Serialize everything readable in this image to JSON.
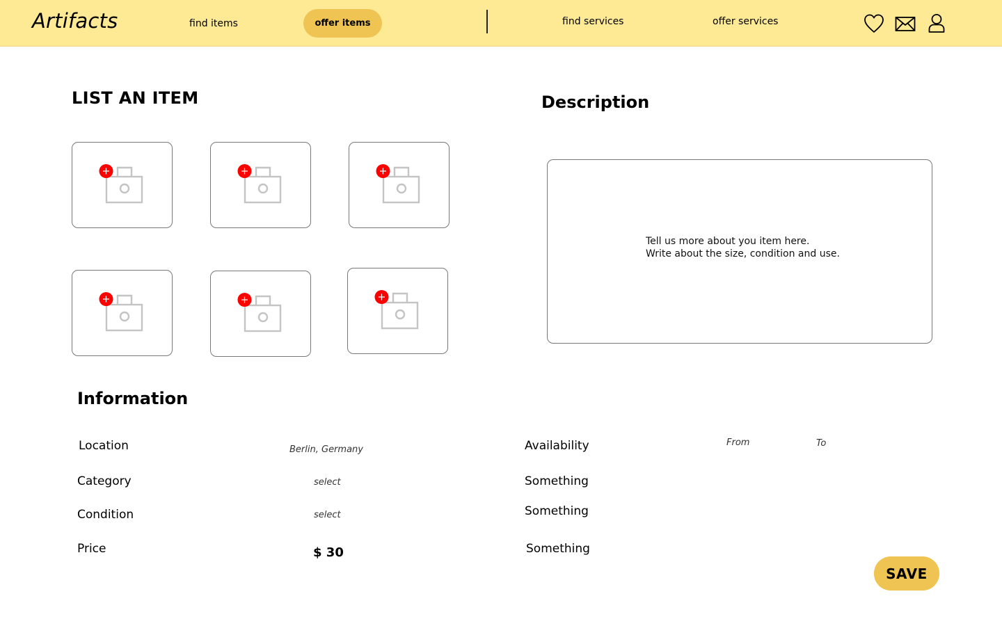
{
  "header": {
    "brand": "Artifacts",
    "nav": {
      "find_items": "find items",
      "offer_items": "offer items",
      "find_services": "find services",
      "offer_services": "offer services"
    },
    "icons": [
      "heart-icon",
      "mail-icon",
      "user-icon"
    ]
  },
  "main": {
    "list_title": "LIST AN ITEM",
    "photo_slots": [
      {
        "icon": "add-photo-icon"
      },
      {
        "icon": "add-photo-icon"
      },
      {
        "icon": "add-photo-icon"
      },
      {
        "icon": "add-photo-icon"
      },
      {
        "icon": "add-photo-icon"
      },
      {
        "icon": "add-photo-icon"
      }
    ],
    "description_title": "Description",
    "description_placeholder_line1": "Tell us more about you item here.",
    "description_placeholder_line2": "Write about the size, condition and use."
  },
  "information": {
    "title": "Information",
    "location_label": "Location",
    "location_value": "Berlin, Germany",
    "category_label": "Category",
    "category_value": "select",
    "condition_label": "Condition",
    "condition_value": "select",
    "price_label": "Price",
    "price_value": "$ 30",
    "availability_label": "Availability",
    "availability_from": "From",
    "availability_to": "To",
    "extra_1": "Something",
    "extra_2": "Something",
    "extra_3": "Something"
  },
  "actions": {
    "save_label": "SAVE"
  },
  "colors": {
    "header_bg": "#FEE995",
    "accent": "#EFC452",
    "add_badge": "#FF0000",
    "camera_icon": "#C4C4C4"
  }
}
